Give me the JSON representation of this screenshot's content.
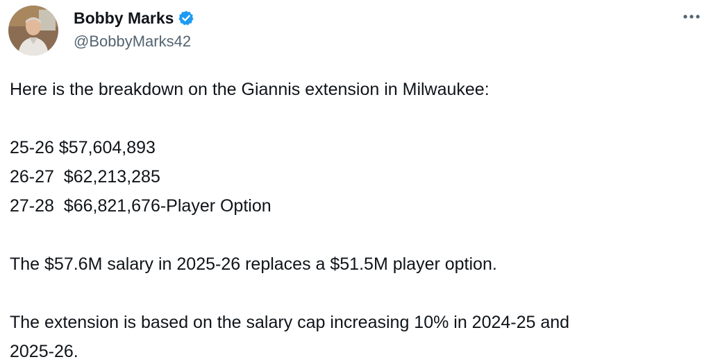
{
  "author": {
    "name": "Bobby Marks",
    "handle": "@BobbyMarks42",
    "verified_color": "#1d9bf0"
  },
  "menu": {
    "more_icon": "more-horizontal-icon"
  },
  "tweet": {
    "intro": "Here is the breakdown on the Giannis extension in Milwaukee:",
    "salary_lines": [
      "25-26 $57,604,893",
      "26-27  $62,213,285",
      "27-28  $66,821,676-Player Option"
    ],
    "note_1": "The $57.6M salary in 2025-26 replaces a $51.5M player option.",
    "note_2_line_1": "The extension is based on the salary cap increasing 10% in 2024-25 and",
    "note_2_line_2": "2025-26."
  }
}
